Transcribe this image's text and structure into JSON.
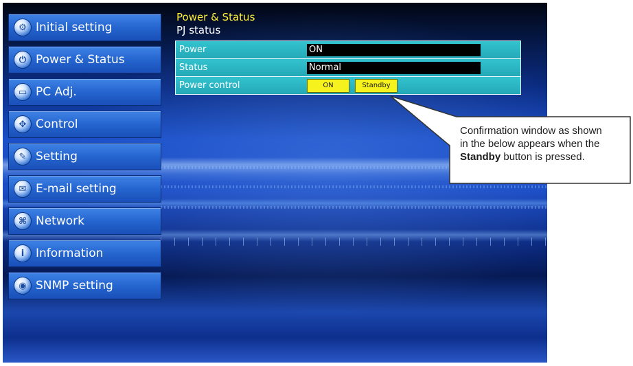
{
  "sidebar": {
    "items": [
      {
        "label": "Initial setting",
        "icon": "initial-setting-icon",
        "glyph": "⚙"
      },
      {
        "label": "Power & Status",
        "icon": "power-icon",
        "glyph": "⏻"
      },
      {
        "label": "PC Adj.",
        "icon": "monitor-icon",
        "glyph": "▭"
      },
      {
        "label": "Control",
        "icon": "control-icon",
        "glyph": "✥"
      },
      {
        "label": "Setting",
        "icon": "wrench-icon",
        "glyph": "✎"
      },
      {
        "label": "E-mail setting",
        "icon": "envelope-icon",
        "glyph": "✉"
      },
      {
        "label": "Network",
        "icon": "network-icon",
        "glyph": "⌘"
      },
      {
        "label": "Information",
        "icon": "information-icon",
        "glyph": "i"
      },
      {
        "label": "SNMP setting",
        "icon": "snmp-icon",
        "glyph": "◉"
      }
    ]
  },
  "header": {
    "title": "Power & Status",
    "subtitle": "PJ status"
  },
  "status_table": {
    "power_label": "Power",
    "power_value": "ON",
    "status_label": "Status",
    "status_value": "Normal",
    "control_label": "Power control",
    "on_button": "ON",
    "standby_button": "Standby"
  },
  "callout": {
    "line1": "Confirmation window  as shown",
    "line2": "in the below appears  when the",
    "bold": "Standby",
    "line3_rest": " button is pressed."
  },
  "colors": {
    "accent_yellow": "#ffef3a",
    "button_yellow": "#f6f21d",
    "table_teal": "#2cb6c4",
    "nav_blue": "#2565cf"
  }
}
